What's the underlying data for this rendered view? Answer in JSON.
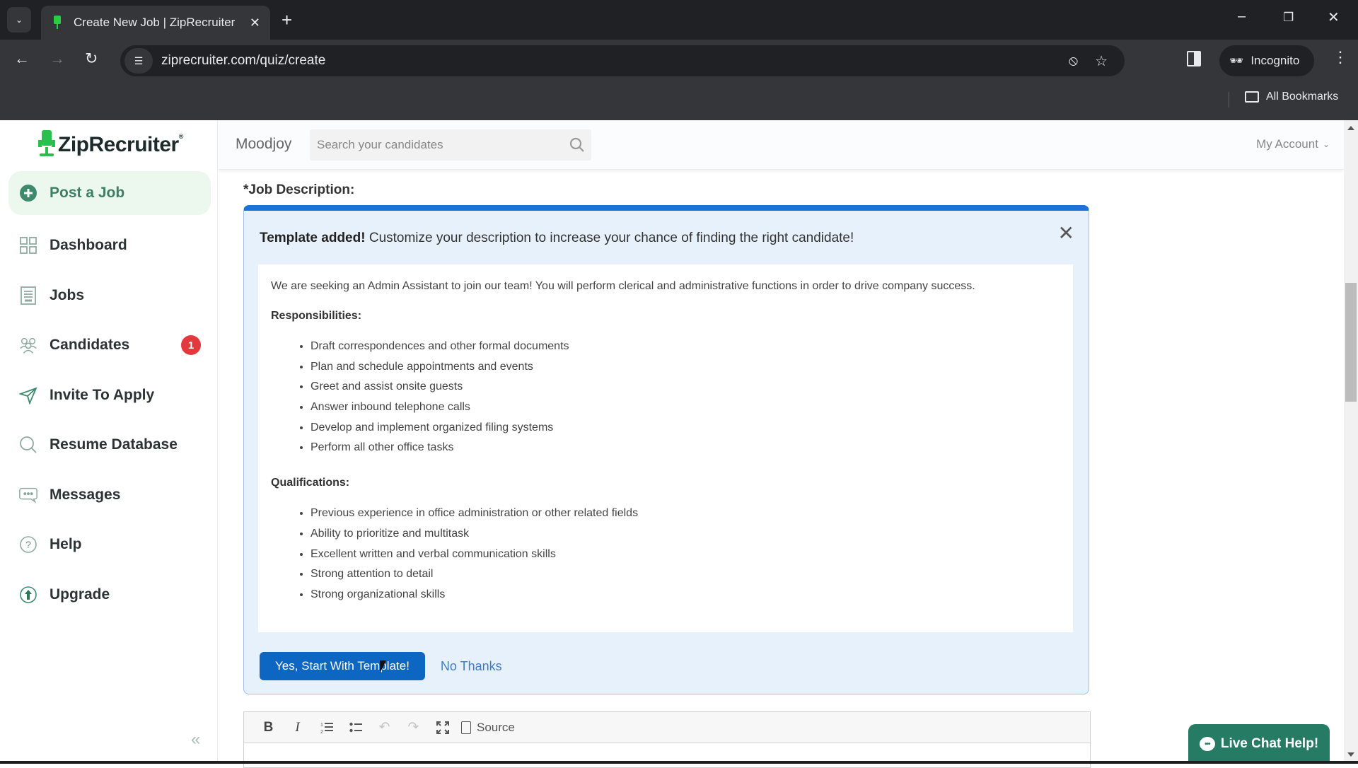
{
  "browser": {
    "tab_title": "Create New Job | ZipRecruiter",
    "url": "ziprecruiter.com/quiz/create",
    "profile_label": "Incognito",
    "bookmarks_label": "All Bookmarks",
    "icons": {
      "tab_list": "chevron-down-icon",
      "close_tab": "close-icon",
      "new_tab": "plus-icon",
      "back": "arrow-left-icon",
      "forward": "arrow-right-icon",
      "reload": "reload-icon",
      "site_info": "tune-icon",
      "tracking": "eye-off-icon",
      "bookmark": "star-icon",
      "side_panel": "side-panel-icon",
      "menu": "more-vert-icon",
      "minimize": "minimize-icon",
      "restore": "restore-icon",
      "close_window": "close-icon"
    }
  },
  "brand": {
    "name": "ZipRecruiter",
    "registered": "®",
    "accent_color": "#2bc04d"
  },
  "sidebar": {
    "items": [
      {
        "label": "Post a Job",
        "icon": "plus-circle-icon",
        "active": true
      },
      {
        "label": "Dashboard",
        "icon": "grid-icon"
      },
      {
        "label": "Jobs",
        "icon": "document-icon"
      },
      {
        "label": "Candidates",
        "icon": "people-icon",
        "badge": "1"
      },
      {
        "label": "Invite To Apply",
        "icon": "send-icon"
      },
      {
        "label": "Resume Database",
        "icon": "search-icon"
      },
      {
        "label": "Messages",
        "icon": "chat-icon"
      },
      {
        "label": "Help",
        "icon": "help-circle-icon"
      },
      {
        "label": "Upgrade",
        "icon": "upgrade-arrow-icon"
      }
    ],
    "collapse_glyph": "«"
  },
  "topbar": {
    "company": "Moodjoy",
    "search_placeholder": "Search your candidates",
    "search_value": "",
    "account_label": "My Account"
  },
  "form": {
    "job_description_label": "*Job Description:",
    "template_panel": {
      "header_bold": "Template added!",
      "header_text": " Customize your description to increase your chance of finding the right candidate!",
      "intro": "We are seeking an Admin Assistant to join our team! You will perform clerical and administrative functions in order to drive company success.",
      "responsibilities_heading": "Responsibilities:",
      "responsibilities": [
        "Draft correspondences and other formal documents",
        "Plan and schedule appointments and events",
        "Greet and assist onsite guests",
        "Answer inbound telephone calls",
        "Develop and implement organized filing systems",
        "Perform all other office tasks"
      ],
      "qualifications_heading": "Qualifications:",
      "qualifications": [
        "Previous experience in office administration or other related fields",
        "Ability to prioritize and multitask",
        "Excellent written and verbal communication skills",
        "Strong attention to detail",
        "Strong organizational skills"
      ],
      "accept_label": "Yes, Start With Template!",
      "decline_label": "No Thanks",
      "accent_color": "#1b73d8"
    },
    "editor_toolbar": {
      "bold": "B",
      "italic": "I",
      "source_label": "Source"
    }
  },
  "live_chat": {
    "label": "Live Chat Help!",
    "color": "#257b63"
  },
  "colors": {
    "badge": "#e2393f",
    "primary_button": "#0d66c2",
    "link": "#3d7cc9"
  }
}
